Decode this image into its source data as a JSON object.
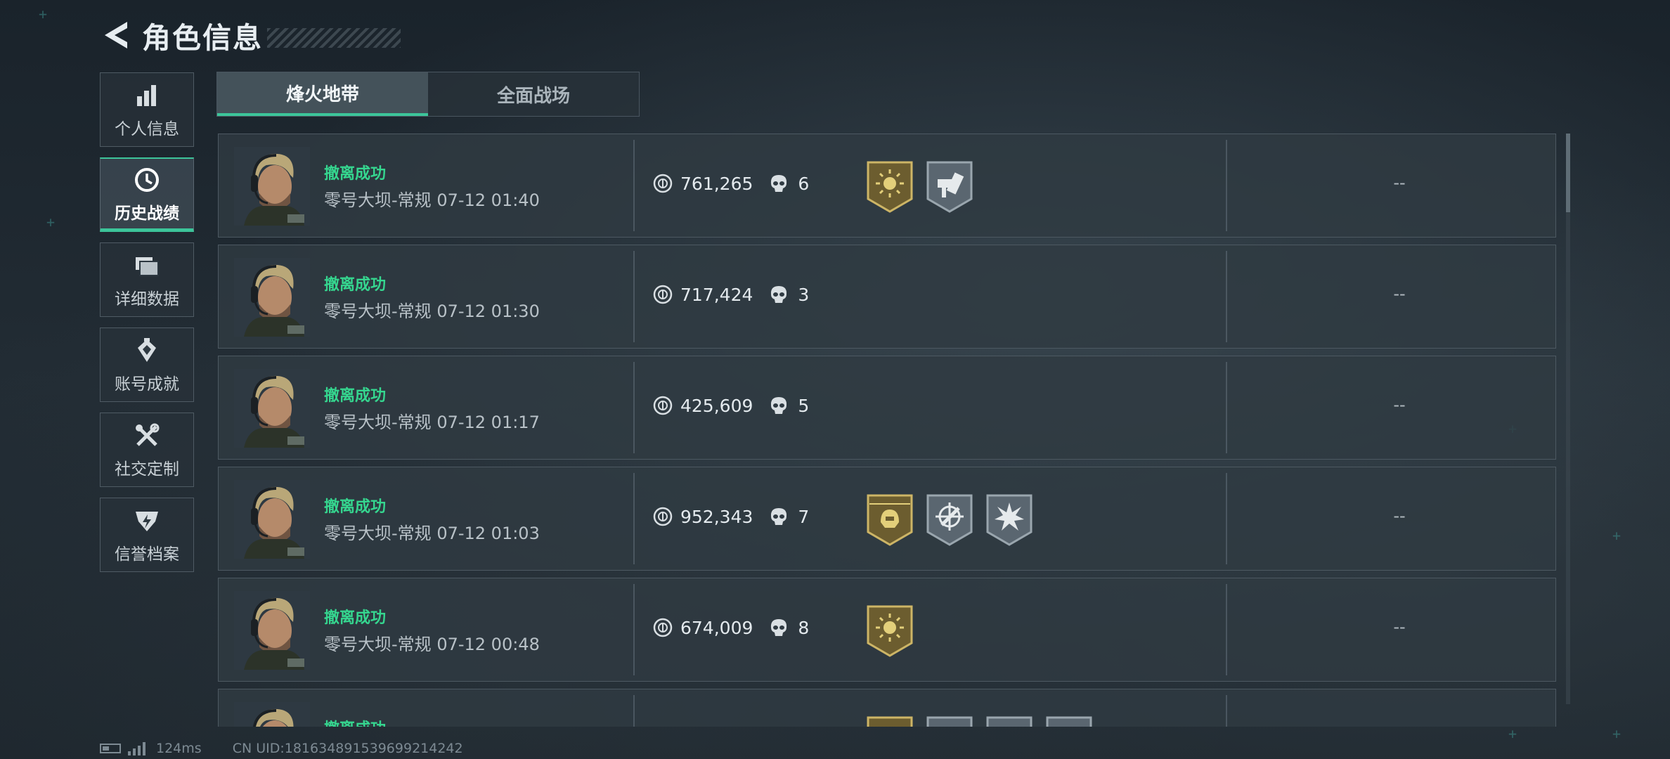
{
  "header": {
    "title": "角色信息"
  },
  "sidebar": {
    "items": [
      {
        "label": "个人信息",
        "icon": "bar-chart-icon"
      },
      {
        "label": "历史战绩",
        "icon": "clock-icon"
      },
      {
        "label": "详细数据",
        "icon": "folder-icon"
      },
      {
        "label": "账号成就",
        "icon": "achievement-icon"
      },
      {
        "label": "社交定制",
        "icon": "tools-icon"
      },
      {
        "label": "信誉档案",
        "icon": "reputation-icon"
      }
    ],
    "active_index": 1
  },
  "tabs": [
    {
      "label": "烽火地带",
      "active": true
    },
    {
      "label": "全面战场",
      "active": false
    }
  ],
  "records": [
    {
      "status": "撤离成功",
      "map": "零号大坝-常规",
      "time": "07-12 01:40",
      "value": "761,265",
      "kills": "6",
      "badges": [
        "gold-sun-badge",
        "gray-hammer-badge"
      ],
      "extra": "--"
    },
    {
      "status": "撤离成功",
      "map": "零号大坝-常规",
      "time": "07-12 01:30",
      "value": "717,424",
      "kills": "3",
      "badges": [],
      "extra": "--"
    },
    {
      "status": "撤离成功",
      "map": "零号大坝-常规",
      "time": "07-12 01:17",
      "value": "425,609",
      "kills": "5",
      "badges": [],
      "extra": "--"
    },
    {
      "status": "撤离成功",
      "map": "零号大坝-常规",
      "time": "07-12 01:03",
      "value": "952,343",
      "kills": "7",
      "badges": [
        "gold-helmet-badge",
        "gray-target-badge",
        "gray-burst-badge"
      ],
      "extra": "--"
    },
    {
      "status": "撤离成功",
      "map": "零号大坝-常规",
      "time": "07-12 00:48",
      "value": "674,009",
      "kills": "8",
      "badges": [
        "gold-sun-badge"
      ],
      "extra": "--"
    },
    {
      "status": "撤离成功",
      "map": "",
      "time": "",
      "value": "",
      "kills": "",
      "badges": [
        "gold-badge",
        "gray-badge",
        "gray-badge",
        "gray-badge"
      ],
      "extra": ""
    }
  ],
  "footer": {
    "ping": "124ms",
    "uid": "CN UID:181634891539699214242"
  },
  "colors": {
    "accent": "#3cc59a",
    "status_green": "#35d68f",
    "gold": "#d8c06a"
  }
}
